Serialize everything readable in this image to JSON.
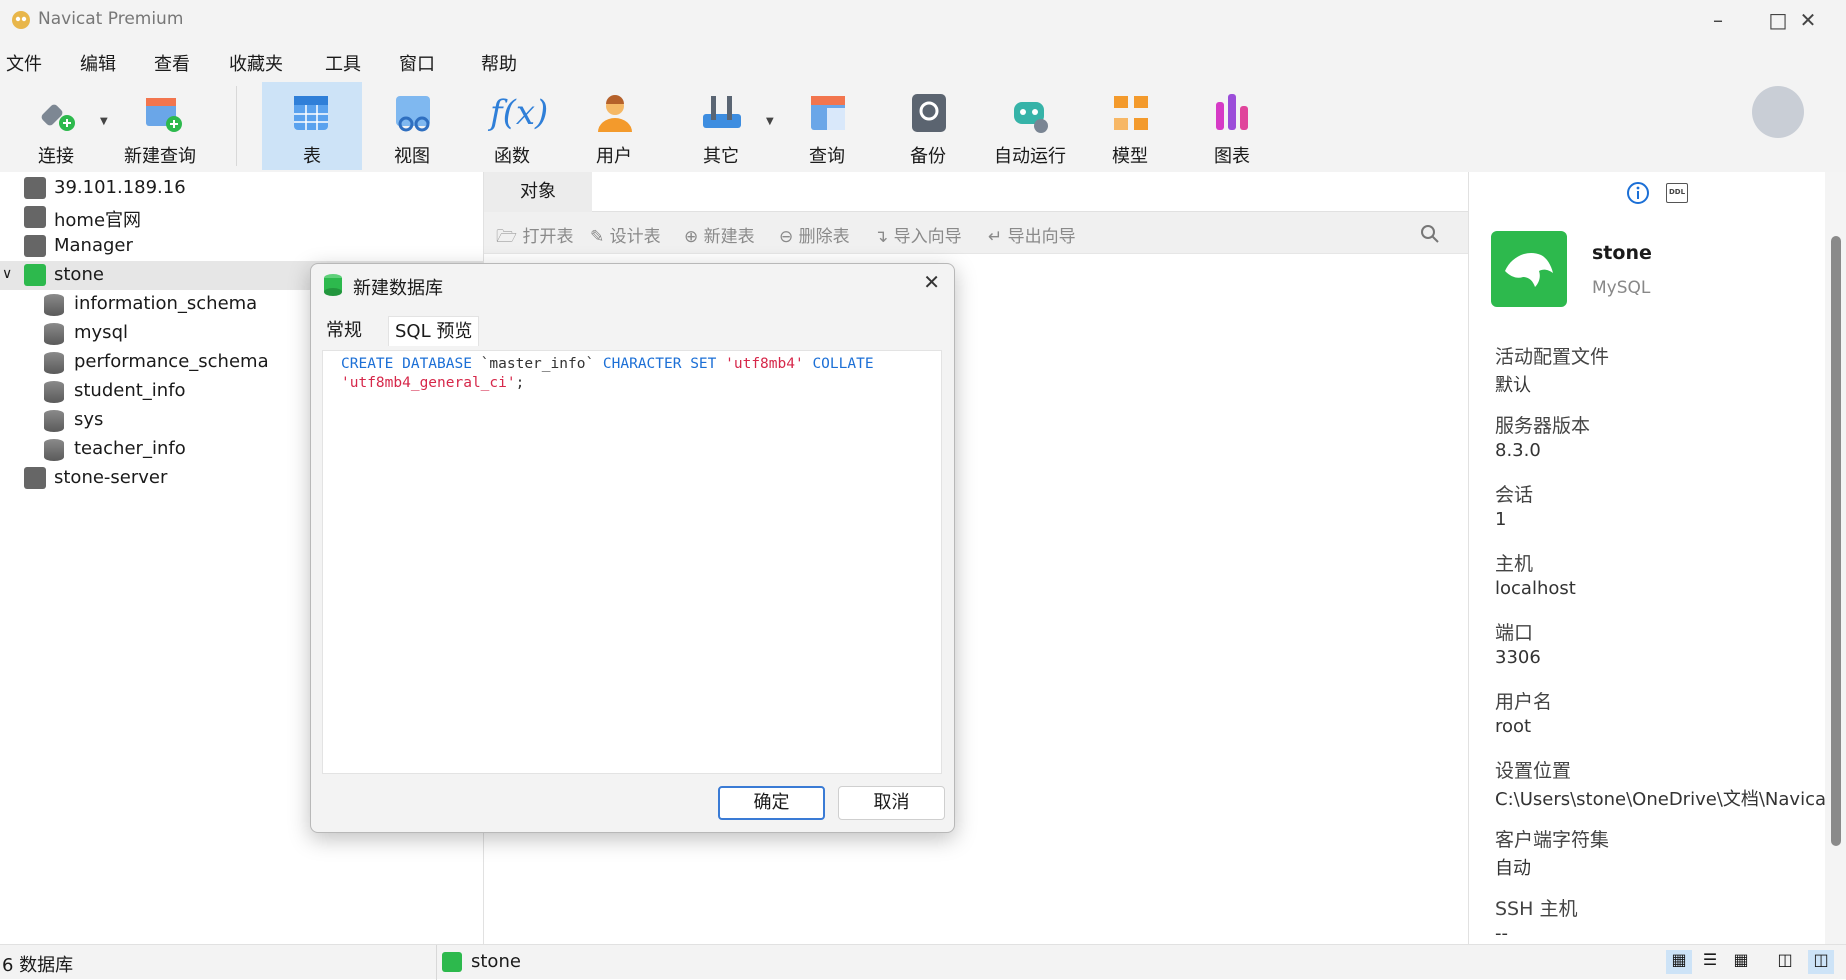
{
  "window": {
    "title": "Navicat Premium"
  },
  "menu": [
    "文件",
    "编辑",
    "查看",
    "收藏夹",
    "工具",
    "窗口",
    "帮助"
  ],
  "toolbar": [
    {
      "label": "连接",
      "icon": "plug-icon"
    },
    {
      "label": "新建查询",
      "icon": "new-query-icon"
    },
    {
      "label": "表",
      "icon": "table-icon",
      "active": true
    },
    {
      "label": "视图",
      "icon": "view-icon"
    },
    {
      "label": "函数",
      "icon": "function-icon"
    },
    {
      "label": "用户",
      "icon": "user-icon"
    },
    {
      "label": "其它",
      "icon": "tools-icon"
    },
    {
      "label": "查询",
      "icon": "query-icon"
    },
    {
      "label": "备份",
      "icon": "backup-icon"
    },
    {
      "label": "自动运行",
      "icon": "robot-icon"
    },
    {
      "label": "模型",
      "icon": "model-icon"
    },
    {
      "label": "图表",
      "icon": "chart-icon"
    }
  ],
  "tree": {
    "connections": [
      "39.101.189.16",
      "home官网",
      "Manager",
      "stone",
      "stone-server"
    ],
    "databases": [
      "information_schema",
      "mysql",
      "performance_schema",
      "student_info",
      "sys",
      "teacher_info"
    ]
  },
  "objects": {
    "tab": "对象",
    "tools": [
      "打开表",
      "设计表",
      "新建表",
      "删除表",
      "导入向导",
      "导出向导"
    ]
  },
  "info": {
    "name": "stone",
    "type": "MySQL",
    "fields": [
      {
        "k": "活动配置文件",
        "v": "默认"
      },
      {
        "k": "服务器版本",
        "v": "8.3.0"
      },
      {
        "k": "会话",
        "v": "1"
      },
      {
        "k": "主机",
        "v": "localhost"
      },
      {
        "k": "端口",
        "v": "3306"
      },
      {
        "k": "用户名",
        "v": "root"
      },
      {
        "k": "设置位置",
        "v": "C:\\Users\\stone\\OneDrive\\文档\\Navicat"
      },
      {
        "k": "客户端字符集",
        "v": "自动"
      },
      {
        "k": "SSH 主机",
        "v": "--"
      }
    ]
  },
  "dialog": {
    "title": "新建数据库",
    "tabs": [
      "常规",
      "SQL 预览"
    ],
    "sql": {
      "kw1": "CREATE DATABASE",
      "name": " `master_info` ",
      "kw2": "CHARACTER SET",
      "charset": "'utf8mb4'",
      "kw3": "COLLATE",
      "collation": "'utf8mb4_general_ci'",
      "end": ";"
    },
    "ok": "确定",
    "cancel": "取消"
  },
  "status": {
    "left": "6 数据库",
    "conn": "stone"
  },
  "colors": {
    "accent": "#1b6fd6",
    "string": "#d6284a",
    "mysql_green": "#2db94d"
  }
}
